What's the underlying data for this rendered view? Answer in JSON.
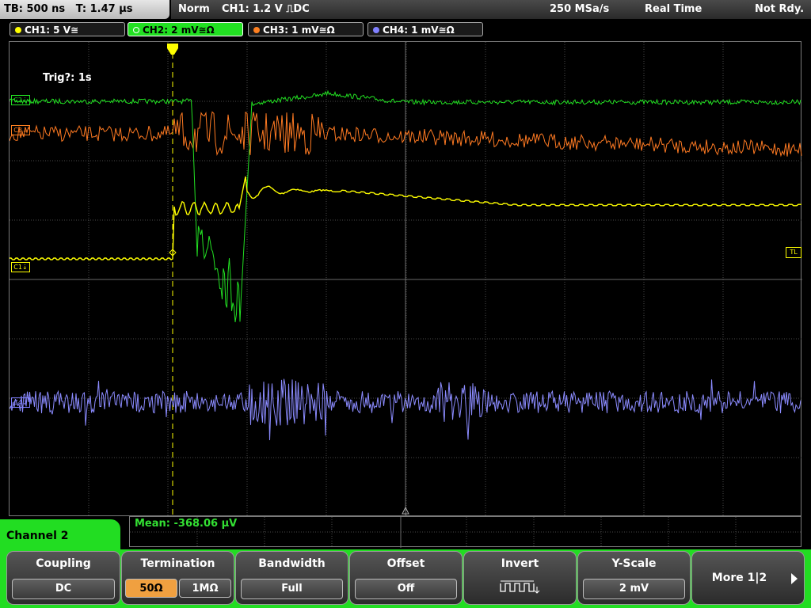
{
  "status": {
    "timebase": "TB: 500 ns",
    "trigger_pos": "T: 1.47 µs",
    "mode": "Norm",
    "trigger": "CH1: 1.2 V ⎍DC",
    "sample_rate": "250 MSa/s",
    "acq_mode": "Real Time",
    "state": "Not Rdy."
  },
  "channels": [
    {
      "label": "CH1: 5 V≅",
      "color": "#ffff00"
    },
    {
      "label": "CH2: 2 mV≅Ω",
      "color": "#22dd22"
    },
    {
      "label": "CH3: 1 mV≅Ω",
      "color": "#ff8020"
    },
    {
      "label": "CH4: 1 mV≅Ω",
      "color": "#8080ff"
    }
  ],
  "screen": {
    "trig_status": "Trig?: 1s",
    "markers": {
      "ch1": "C1⇣",
      "ch2": "C2⇣",
      "ch3": "C3⇣",
      "ch4": "C4⇣",
      "tl": "TL"
    }
  },
  "measurement": "Mean: -368.06 µV",
  "menu": {
    "title": "Channel 2",
    "coupling": {
      "title": "Coupling",
      "value": "DC"
    },
    "termination": {
      "title": "Termination",
      "opt1": "50Ω",
      "opt2": "1MΩ"
    },
    "bandwidth": {
      "title": "Bandwidth",
      "value": "Full"
    },
    "offset": {
      "title": "Offset",
      "value": "Off"
    },
    "invert": {
      "title": "Invert"
    },
    "yscale": {
      "title": "Y-Scale",
      "value": "2 mV"
    },
    "more": {
      "label": "More 1|2"
    }
  }
}
